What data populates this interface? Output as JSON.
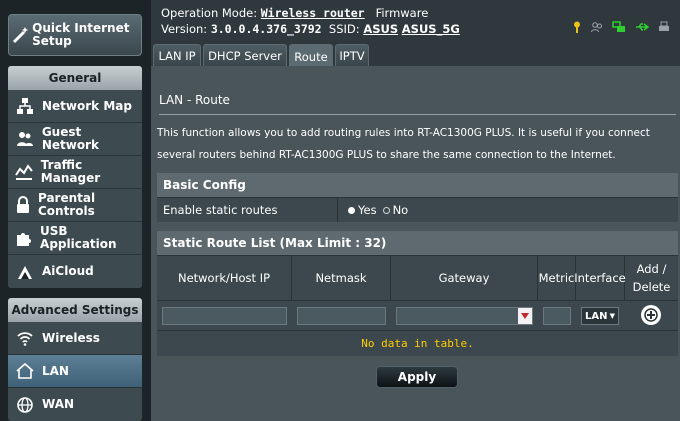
{
  "sidebar": {
    "quick_setup": "Quick Internet Setup",
    "general_title": "General",
    "general_items": [
      {
        "label": "Network Map",
        "icon": "network-map-icon"
      },
      {
        "label": "Guest Network",
        "icon": "guest-network-icon"
      },
      {
        "label": "Traffic Manager",
        "icon": "traffic-manager-icon"
      },
      {
        "label": "Parental Controls",
        "icon": "lock-icon"
      },
      {
        "label": "USB Application",
        "icon": "puzzle-icon"
      },
      {
        "label": "AiCloud",
        "icon": "cloud-icon"
      }
    ],
    "advanced_title": "Advanced Settings",
    "advanced_items": [
      {
        "label": "Wireless",
        "icon": "wifi-icon"
      },
      {
        "label": "LAN",
        "icon": "home-icon",
        "active": true
      },
      {
        "label": "WAN",
        "icon": "globe-icon"
      }
    ]
  },
  "header": {
    "op_mode_label": "Operation Mode:",
    "op_mode_value": "Wireless router",
    "firmware_label": "Firmware",
    "version_label": "Version:",
    "version_value": "3.0.0.4.376_3792",
    "ssid_label": "SSID:",
    "ssid_1": "ASUS",
    "ssid_2": "ASUS_5G"
  },
  "tabs": [
    "LAN IP",
    "DHCP Server",
    "Route",
    "IPTV"
  ],
  "active_tab": "Route",
  "content": {
    "title": "LAN - Route",
    "description": "This function allows you to add routing rules into RT-AC1300G PLUS. It is useful if you connect several routers behind RT-AC1300G PLUS to share the same connection to the Internet.",
    "basic_config_title": "Basic Config",
    "enable_static_label": "Enable static routes",
    "radio_yes": "Yes",
    "radio_no": "No",
    "static_list_title": "Static Route List (Max Limit : 32)",
    "columns": {
      "network": "Network/Host IP",
      "netmask": "Netmask",
      "gateway": "Gateway",
      "metric": "Metric",
      "interface": "Interface",
      "add_delete": "Add / Delete"
    },
    "interface_value": "LAN",
    "no_data": "No data in table.",
    "apply_label": "Apply"
  },
  "colors": {
    "accent_active": "#4f7189",
    "no_data_text": "#ffcc00",
    "gateway_arrow": "#c0262d"
  }
}
